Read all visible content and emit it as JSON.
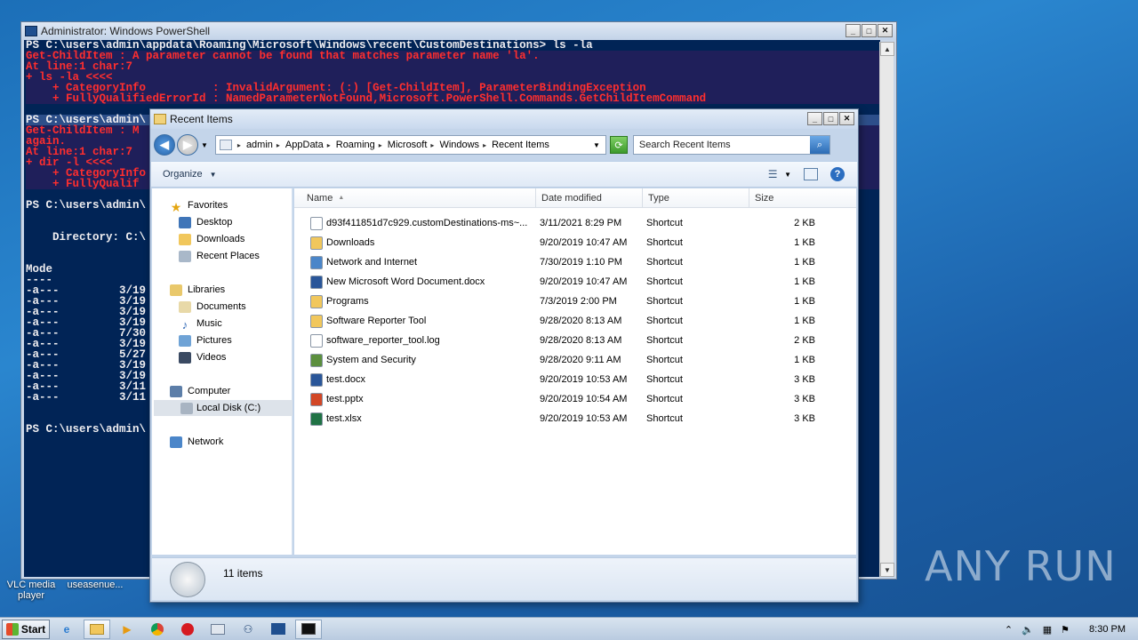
{
  "desktop": {
    "icons": [
      {
        "label": "VLC media player"
      },
      {
        "label": "useasenue..."
      }
    ]
  },
  "powershell": {
    "title": "Administrator: Windows PowerShell",
    "lines": [
      {
        "text": "PS C:\\users\\admin\\appdata\\Roaming\\Microsoft\\Windows\\recent\\CustomDestinations> ls -la",
        "kind": "normal"
      },
      {
        "text": "Get-ChildItem : A parameter cannot be found that matches parameter name 'la'.",
        "kind": "err"
      },
      {
        "text": "At line:1 char:7",
        "kind": "err"
      },
      {
        "text": "+ ls -la <<<<",
        "kind": "err"
      },
      {
        "text": "    + CategoryInfo          : InvalidArgument: (:) [Get-ChildItem], ParameterBindingException",
        "kind": "err"
      },
      {
        "text": "    + FullyQualifiedErrorId : NamedParameterNotFound,Microsoft.PowerShell.Commands.GetChildItemCommand",
        "kind": "err"
      },
      {
        "text": "",
        "kind": "normal"
      },
      {
        "text": "PS C:\\users\\admin\\",
        "kind": "sel"
      },
      {
        "text": "Get-ChildItem : M",
        "kind": "err"
      },
      {
        "text": "again.",
        "kind": "err"
      },
      {
        "text": "At line:1 char:7",
        "kind": "err"
      },
      {
        "text": "+ dir -l <<<<",
        "kind": "err"
      },
      {
        "text": "    + CategoryInfo",
        "kind": "err"
      },
      {
        "text": "    + FullyQualif",
        "kind": "err"
      },
      {
        "text": "",
        "kind": "normal"
      },
      {
        "text": "PS C:\\users\\admin\\",
        "kind": "normal"
      },
      {
        "text": "",
        "kind": "normal"
      },
      {
        "text": "",
        "kind": "normal"
      },
      {
        "text": "    Directory: C:\\",
        "kind": "normal"
      },
      {
        "text": "",
        "kind": "normal"
      },
      {
        "text": "",
        "kind": "normal"
      },
      {
        "text": "Mode",
        "kind": "normal"
      },
      {
        "text": "----",
        "kind": "normal"
      },
      {
        "text": "-a---         3/19",
        "kind": "normal"
      },
      {
        "text": "-a---         3/19",
        "kind": "normal"
      },
      {
        "text": "-a---         3/19",
        "kind": "normal"
      },
      {
        "text": "-a---         3/19",
        "kind": "normal"
      },
      {
        "text": "-a---         7/30",
        "kind": "normal"
      },
      {
        "text": "-a---         3/19",
        "kind": "normal"
      },
      {
        "text": "-a---         5/27",
        "kind": "normal"
      },
      {
        "text": "-a---         3/19",
        "kind": "normal"
      },
      {
        "text": "-a---         3/19",
        "kind": "normal"
      },
      {
        "text": "-a---         3/11",
        "kind": "normal"
      },
      {
        "text": "-a---         3/11",
        "kind": "normal"
      },
      {
        "text": "",
        "kind": "normal"
      },
      {
        "text": "",
        "kind": "normal"
      },
      {
        "text": "PS C:\\users\\admin\\",
        "kind": "normal"
      }
    ]
  },
  "explorer": {
    "title": "Recent Items",
    "breadcrumbs": [
      "admin",
      "AppData",
      "Roaming",
      "Microsoft",
      "Windows",
      "Recent Items"
    ],
    "search_placeholder": "Search Recent Items",
    "organize_label": "Organize",
    "nav": {
      "favorites": "Favorites",
      "desktop": "Desktop",
      "downloads": "Downloads",
      "recent_places": "Recent Places",
      "libraries": "Libraries",
      "documents": "Documents",
      "music": "Music",
      "pictures": "Pictures",
      "videos": "Videos",
      "computer": "Computer",
      "local_disk": "Local Disk (C:)",
      "network": "Network"
    },
    "columns": {
      "name": "Name",
      "date": "Date modified",
      "type": "Type",
      "size": "Size"
    },
    "files": [
      {
        "name": "d93f411851d7c929.customDestinations-ms~...",
        "date": "3/11/2021 8:29 PM",
        "type": "Shortcut",
        "size": "2 KB",
        "icon": "generic-file",
        "color": "#ffffff"
      },
      {
        "name": "Downloads",
        "date": "9/20/2019 10:47 AM",
        "type": "Shortcut",
        "size": "1 KB",
        "icon": "folder",
        "color": "#f1c75c"
      },
      {
        "name": "Network and Internet",
        "date": "7/30/2019 1:10 PM",
        "type": "Shortcut",
        "size": "1 KB",
        "icon": "network",
        "color": "#4b86c9"
      },
      {
        "name": "New Microsoft Word Document.docx",
        "date": "9/20/2019 10:47 AM",
        "type": "Shortcut",
        "size": "1 KB",
        "icon": "word",
        "color": "#2a5699"
      },
      {
        "name": "Programs",
        "date": "7/3/2019 2:00 PM",
        "type": "Shortcut",
        "size": "1 KB",
        "icon": "folder",
        "color": "#f1c75c"
      },
      {
        "name": "Software Reporter Tool",
        "date": "9/28/2020 8:13 AM",
        "type": "Shortcut",
        "size": "1 KB",
        "icon": "folder",
        "color": "#f1c75c"
      },
      {
        "name": "software_reporter_tool.log",
        "date": "9/28/2020 8:13 AM",
        "type": "Shortcut",
        "size": "2 KB",
        "icon": "text-file",
        "color": "#ffffff"
      },
      {
        "name": "System and Security",
        "date": "9/28/2020 9:11 AM",
        "type": "Shortcut",
        "size": "1 KB",
        "icon": "shield",
        "color": "#5b8f3e"
      },
      {
        "name": "test.docx",
        "date": "9/20/2019 10:53 AM",
        "type": "Shortcut",
        "size": "3 KB",
        "icon": "word",
        "color": "#2a5699"
      },
      {
        "name": "test.pptx",
        "date": "9/20/2019 10:54 AM",
        "type": "Shortcut",
        "size": "3 KB",
        "icon": "powerpoint",
        "color": "#d24726"
      },
      {
        "name": "test.xlsx",
        "date": "9/20/2019 10:53 AM",
        "type": "Shortcut",
        "size": "3 KB",
        "icon": "excel",
        "color": "#207245"
      }
    ],
    "status": "11 items"
  },
  "watermark": "ANY RUN",
  "taskbar": {
    "start_label": "Start",
    "clock": "8:30 PM"
  }
}
